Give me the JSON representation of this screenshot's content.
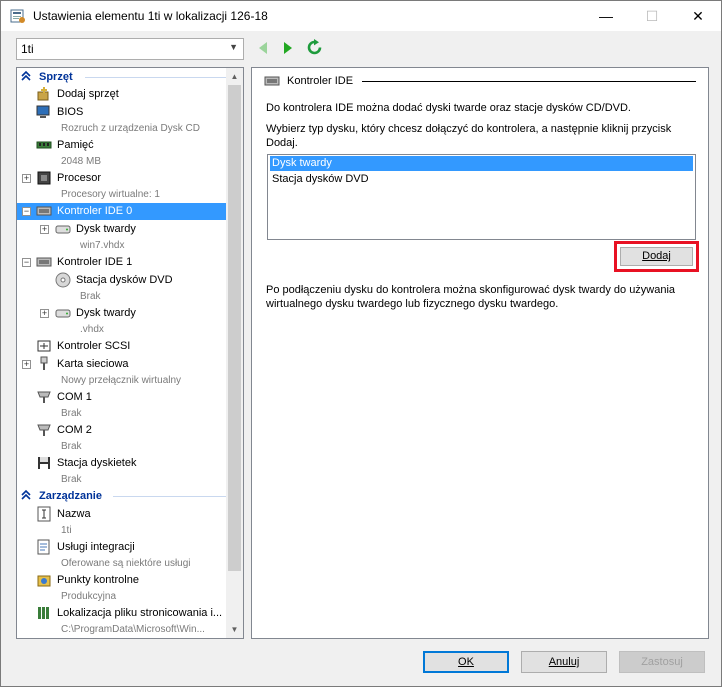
{
  "window": {
    "title": "Ustawienia elementu 1ti w lokalizacji 126-18",
    "minimize": "—",
    "maximize": "☐",
    "close": "✕"
  },
  "vm_selector": {
    "value": "1ti"
  },
  "sidebar": {
    "hardware_header": "Sprzęt",
    "management_header": "Zarządzanie",
    "items": [
      {
        "label": "Dodaj sprzęt",
        "icon": "add-hardware-icon"
      },
      {
        "label": "BIOS",
        "sub": "Rozruch z urządzenia Dysk CD",
        "icon": "bios-icon"
      },
      {
        "label": "Pamięć",
        "sub": "2048 MB",
        "icon": "memory-icon"
      },
      {
        "label": "Procesor",
        "sub": "Procesory wirtualne: 1",
        "icon": "processor-icon"
      },
      {
        "label": "Kontroler IDE 0",
        "icon": "ide-controller-icon",
        "selected": true
      },
      {
        "label": "Dysk twardy",
        "sub": "win7.vhdx",
        "icon": "hard-disk-icon"
      },
      {
        "label": "Kontroler IDE 1",
        "icon": "ide-controller-icon"
      },
      {
        "label": "Stacja dysków DVD",
        "sub": "Brak",
        "icon": "dvd-icon"
      },
      {
        "label": "Dysk twardy",
        "sub": ".vhdx",
        "icon": "hard-disk-icon"
      },
      {
        "label": "Kontroler SCSI",
        "icon": "scsi-icon"
      },
      {
        "label": "Karta sieciowa",
        "sub": "Nowy przełącznik wirtualny",
        "icon": "network-icon"
      },
      {
        "label": "COM 1",
        "sub": "Brak",
        "icon": "com-port-icon"
      },
      {
        "label": "COM 2",
        "sub": "Brak",
        "icon": "com-port-icon"
      },
      {
        "label": "Stacja dyskietek",
        "sub": "Brak",
        "icon": "floppy-icon"
      }
    ],
    "mgmt_items": [
      {
        "label": "Nazwa",
        "sub": "1ti",
        "icon": "name-icon"
      },
      {
        "label": "Usługi integracji",
        "sub": "Oferowane są niektóre usługi",
        "icon": "integration-icon"
      },
      {
        "label": "Punkty kontrolne",
        "sub": "Produkcyjna",
        "icon": "checkpoint-icon"
      },
      {
        "label": "Lokalizacja pliku stronicowania i...",
        "sub": "C:\\ProgramData\\Microsoft\\Win...",
        "icon": "paging-file-icon"
      }
    ]
  },
  "main": {
    "section_title": "Kontroler IDE",
    "intro": "Do kontrolera IDE można dodać dyski twarde oraz stacje dysków CD/DVD.",
    "instruction": "Wybierz typ dysku, który chcesz dołączyć do kontrolera, a następnie kliknij przycisk Dodaj.",
    "disk_types": [
      "Dysk twardy",
      "Stacja dysków DVD"
    ],
    "add_label": "Dodaj",
    "after_note": "Po podłączeniu dysku do kontrolera można skonfigurować dysk twardy do używania wirtualnego dysku twardego lub fizycznego dysku twardego."
  },
  "footer": {
    "ok_label": "OK",
    "cancel_label": "Anuluj",
    "apply_label": "Zastosuj"
  }
}
